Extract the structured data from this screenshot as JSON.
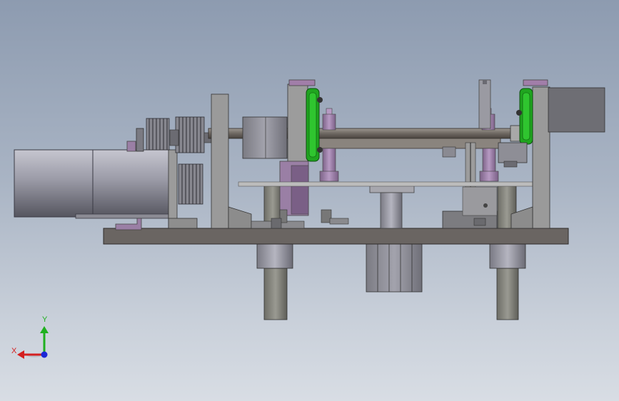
{
  "viewport": {
    "background_top": "#8d9bb0",
    "background_bottom": "#d8dde4"
  },
  "triad": {
    "x_label": "X",
    "y_label": "Y",
    "x_color": "#d42020",
    "y_color": "#1fb01f",
    "z_color": "#1c28d6"
  },
  "colors": {
    "steel": "#8e8e8e",
    "steel_dark": "#5c5c5c",
    "base_plate": "#6a6562",
    "bracket": "#9a9a9a",
    "motor": "#8c8c98",
    "pulley_green": "#1fa51f",
    "purple": "#9b7fa8",
    "pillar": "#6b6b63"
  }
}
